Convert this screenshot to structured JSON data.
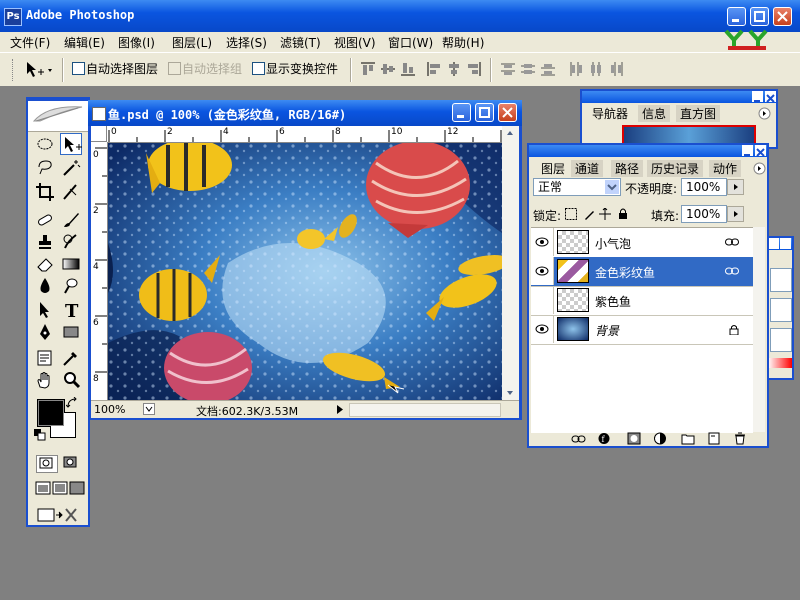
{
  "app": {
    "title": "Adobe Photoshop",
    "icon_label": "Ps"
  },
  "menu": [
    "文件(F)",
    "编辑(E)",
    "图像(I)",
    "图层(L)",
    "选择(S)",
    "滤镜(T)",
    "视图(V)",
    "窗口(W)",
    "帮助(H)"
  ],
  "options": {
    "auto_select_layer": "自动选择图层",
    "auto_select_group": "自动选择组",
    "show_transform": "显示变换控件"
  },
  "document": {
    "title": "鱼.psd @ 100% (金色彩纹鱼, RGB/16#)",
    "zoom": "100%",
    "doc_size": "文档:602.3K/3.53M",
    "ruler_h": [
      "0",
      "2",
      "4",
      "6",
      "8",
      "10",
      "12"
    ],
    "ruler_v": [
      "0",
      "2",
      "4",
      "6",
      "8"
    ]
  },
  "navigator": {
    "tabs": [
      "导航器",
      "信息",
      "直方图"
    ]
  },
  "layers": {
    "tabs": [
      "图层",
      "通道",
      "路径",
      "历史记录",
      "动作"
    ],
    "blend_mode": "正常",
    "opacity_label": "不透明度:",
    "opacity": "100%",
    "lock_label": "锁定:",
    "fill_label": "填充:",
    "fill": "100%",
    "items": [
      {
        "name": "小气泡",
        "visible": true,
        "linked": true
      },
      {
        "name": "金色彩纹鱼",
        "visible": true,
        "linked": true,
        "selected": true
      },
      {
        "name": "紫色鱼",
        "visible": false,
        "linked": false
      },
      {
        "name": "背景",
        "visible": true,
        "locked": true
      }
    ]
  },
  "colors": {
    "xp_blue": "#0a55e0",
    "selection": "#316ac5",
    "foreground": "#000000",
    "background": "#ffffff"
  }
}
